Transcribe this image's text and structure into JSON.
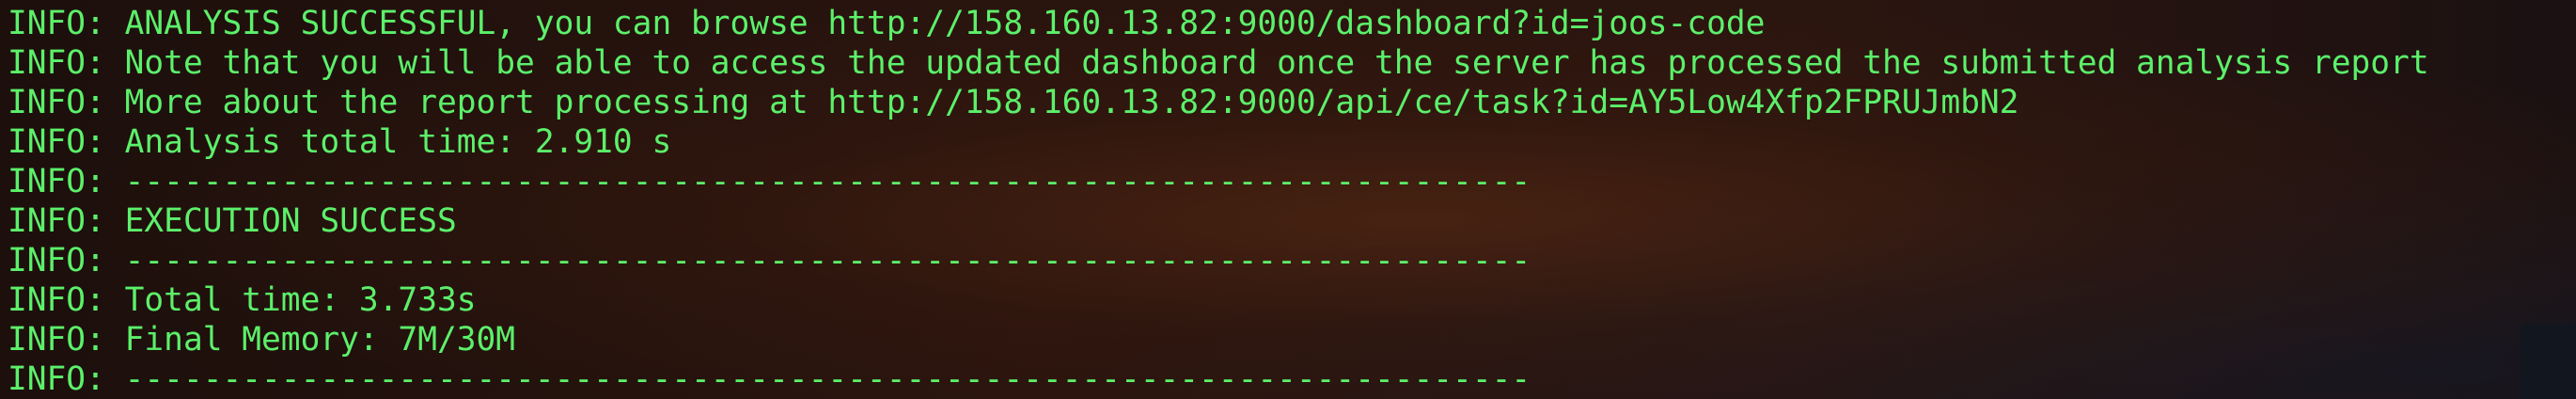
{
  "terminal": {
    "colors": {
      "text": "#5cf06a",
      "background": "#1c0f0c"
    },
    "lines": [
      {
        "prefix": "INFO:",
        "message": "ANALYSIS SUCCESSFUL, you can browse http://158.160.13.82:9000/dashboard?id=joos-code"
      },
      {
        "prefix": "INFO:",
        "message": "Note that you will be able to access the updated dashboard once the server has processed the submitted analysis report"
      },
      {
        "prefix": "INFO:",
        "message": "More about the report processing at http://158.160.13.82:9000/api/ce/task?id=AY5Low4Xfp2FPRUJmbN2"
      },
      {
        "prefix": "INFO:",
        "message": "Analysis total time: 2.910 s"
      },
      {
        "prefix": "INFO:",
        "message": "------------------------------------------------------------------------"
      },
      {
        "prefix": "INFO:",
        "message": "EXECUTION SUCCESS"
      },
      {
        "prefix": "INFO:",
        "message": "------------------------------------------------------------------------"
      },
      {
        "prefix": "INFO:",
        "message": "Total time: 3.733s"
      },
      {
        "prefix": "INFO:",
        "message": "Final Memory: 7M/30M"
      },
      {
        "prefix": "INFO:",
        "message": "------------------------------------------------------------------------"
      }
    ]
  }
}
